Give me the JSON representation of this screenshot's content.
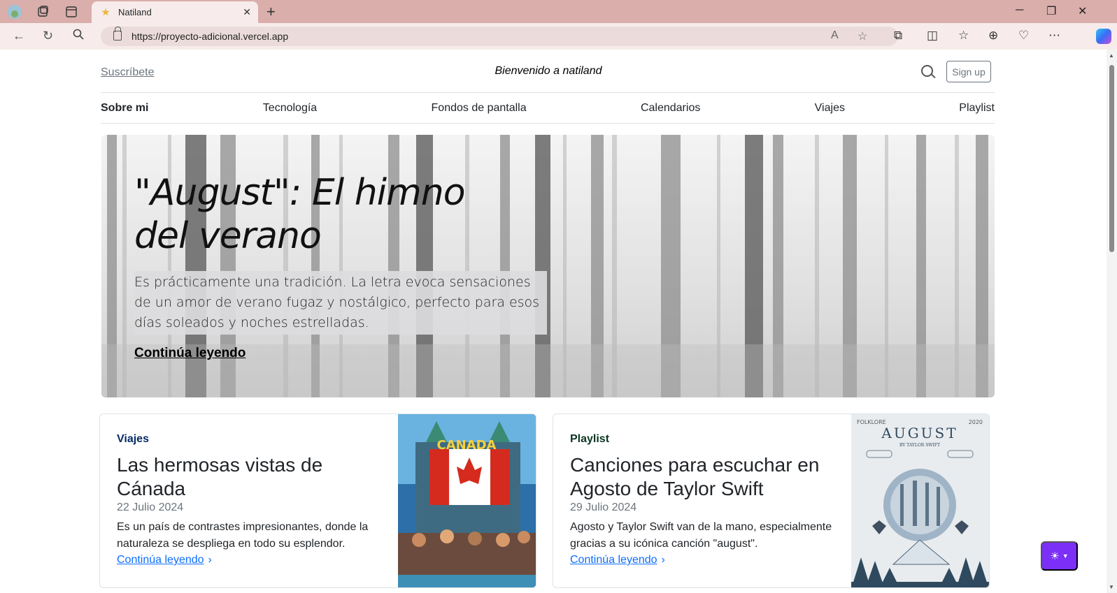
{
  "browser": {
    "tab_title": "Natiland",
    "url": "https://proyecto-adicional.vercel.app"
  },
  "header": {
    "subscribe": "Suscríbete",
    "brand": "Bienvenido a natiland",
    "signup": "Sign up"
  },
  "nav": [
    "Sobre mi",
    "Tecnología",
    "Fondos de pantalla",
    "Calendarios",
    "Viajes",
    "Playlist"
  ],
  "hero": {
    "title": "\"August\": El himno del verano",
    "text": "Es prácticamente una tradición. La letra evoca sensaciones de un amor de verano fugaz y nostálgico, perfecto para esos días soleados y noches estrelladas.",
    "link": "Continúa leyendo"
  },
  "cards": [
    {
      "category": "Viajes",
      "category_color": "#052c65",
      "title": "Las hermosas vistas de Cánada",
      "date": "22 Julio 2024",
      "description": "Es un país de contrastes impresionantes, donde la naturaleza se despliega en todo su esplendor.",
      "link": "Continúa leyendo",
      "image_label": "CANADA"
    },
    {
      "category": "Playlist",
      "category_color": "#0a3622",
      "title": "Canciones para escuchar en Agosto de Taylor Swift",
      "date": "29 Julio 2024",
      "description": "Agosto y Taylor Swift van de la mano, especialmente gracias a su icónica canción \"august\".",
      "link": "Continúa leyendo",
      "image_label": "AUGUST",
      "image_sub": "BY TAYLOR SWIFT",
      "image_top_left": "FOLKLORE",
      "image_top_right": "2020"
    }
  ],
  "colors": {
    "accent": "#0d6efd",
    "theme_button": "#7b2ff7",
    "browser_frame": "#d9aeab"
  }
}
